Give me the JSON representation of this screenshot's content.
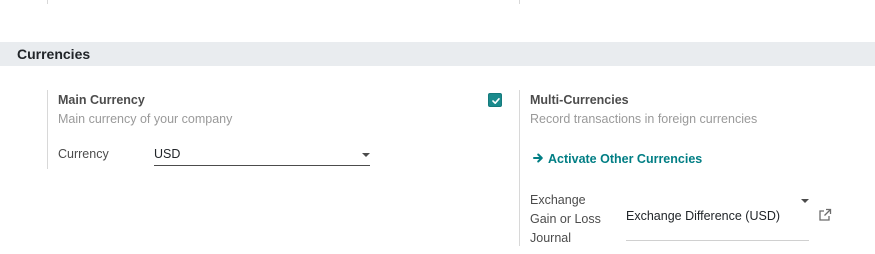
{
  "section": {
    "title": "Currencies"
  },
  "main_currency": {
    "title": "Main Currency",
    "description": "Main currency of your company",
    "field_label": "Currency",
    "field_value": "USD"
  },
  "multi_currencies": {
    "title": "Multi-Currencies",
    "description": "Record transactions in foreign currencies",
    "checked": true,
    "link_label": "Activate Other Currencies",
    "journal_label_line1": "Exchange",
    "journal_label_line2": "Gain or Loss",
    "journal_label_line3": "Journal",
    "journal_value": "Exchange Difference (USD)"
  },
  "colors": {
    "accent": "#017e84",
    "checkbox": "#1a8a8c",
    "section_bg": "#e9ecef"
  },
  "icons": {
    "checkbox": "check-icon",
    "link": "arrow-right-icon",
    "external": "external-link-icon",
    "dropdown": "caret-down-icon"
  }
}
